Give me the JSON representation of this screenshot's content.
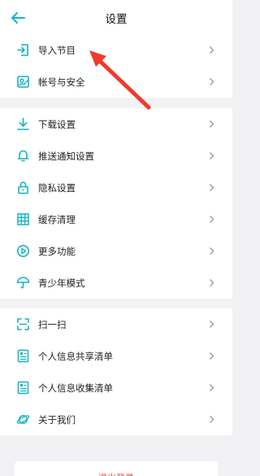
{
  "header": {
    "title": "设置",
    "back_icon": "back-arrow-icon"
  },
  "accent_color": "#13b4c4",
  "groups": [
    {
      "items": [
        {
          "label": "导入节目",
          "icon": "import-icon"
        },
        {
          "label": "帐号与安全",
          "icon": "account-security-icon"
        }
      ]
    },
    {
      "items": [
        {
          "label": "下载设置",
          "icon": "download-icon"
        },
        {
          "label": "推送通知设置",
          "icon": "bell-icon"
        },
        {
          "label": "隐私设置",
          "icon": "lock-icon"
        },
        {
          "label": "缓存清理",
          "icon": "grid-cache-icon"
        },
        {
          "label": "更多功能",
          "icon": "play-circle-icon"
        },
        {
          "label": "青少年模式",
          "icon": "umbrella-icon"
        }
      ]
    },
    {
      "items": [
        {
          "label": "扫一扫",
          "icon": "scan-icon"
        },
        {
          "label": "个人信息共享清单",
          "icon": "document-list-icon"
        },
        {
          "label": "个人信息收集清单",
          "icon": "document-list-icon"
        },
        {
          "label": "关于我们",
          "icon": "planet-icon"
        }
      ]
    }
  ],
  "logout": {
    "label": "退出登录",
    "color": "#e03a3a"
  },
  "annotation": {
    "color": "#f03a2a",
    "icon": "red-pointer-arrow"
  }
}
